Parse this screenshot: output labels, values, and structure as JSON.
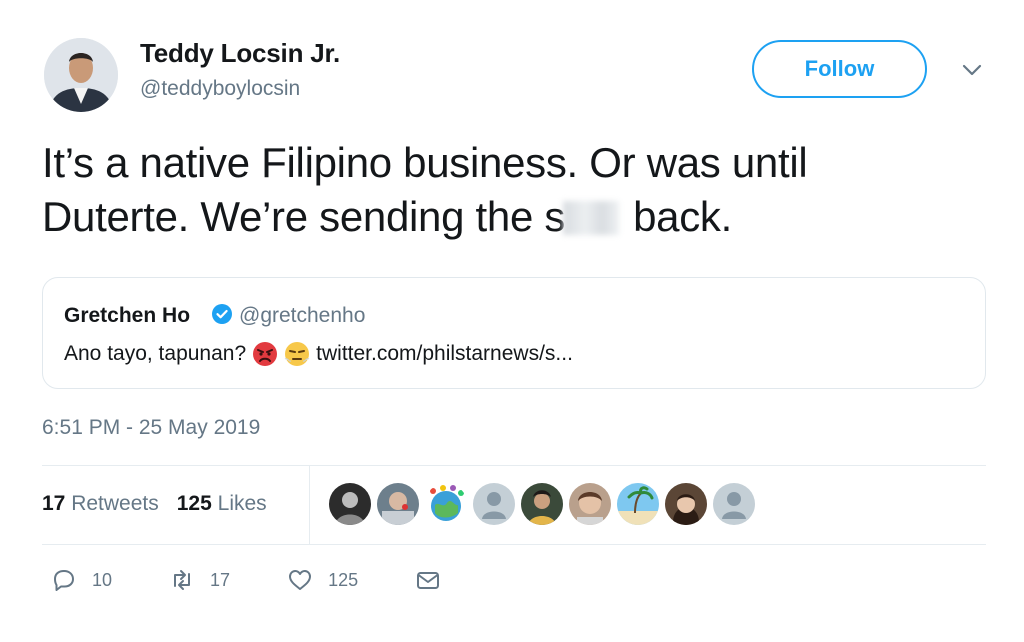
{
  "author": {
    "name": "Teddy Locsin Jr.",
    "handle": "@teddyboylocsin"
  },
  "follow_button": {
    "label": "Follow"
  },
  "tweet": {
    "text_line1": "It’s a native Filipino business. Or was until",
    "text_line2_before": "Duterte. We’re sending the s",
    "text_line2_after": "back."
  },
  "quoted_tweet": {
    "name": "Gretchen Ho",
    "handle": "@gretchenho",
    "text": "Ano tayo, tapunan?",
    "link": "twitter.com/philstarnews/s..."
  },
  "timestamp": "6:51 PM - 25 May 2019",
  "stats": {
    "retweets_count": "17",
    "retweets_label": "Retweets",
    "likes_count": "125",
    "likes_label": "Likes"
  },
  "actions": {
    "replies": "10",
    "retweets": "17",
    "likes": "125"
  },
  "icons": {
    "reply": "reply-icon",
    "retweet": "retweet-icon",
    "like": "heart-icon",
    "message": "envelope-icon",
    "caret": "chevron-down-icon",
    "verified": "verified-badge-icon"
  },
  "colors": {
    "brand": "#1da1f2",
    "secondary_text": "#657786",
    "primary_text": "#14171a",
    "border": "#e1e8ed"
  }
}
